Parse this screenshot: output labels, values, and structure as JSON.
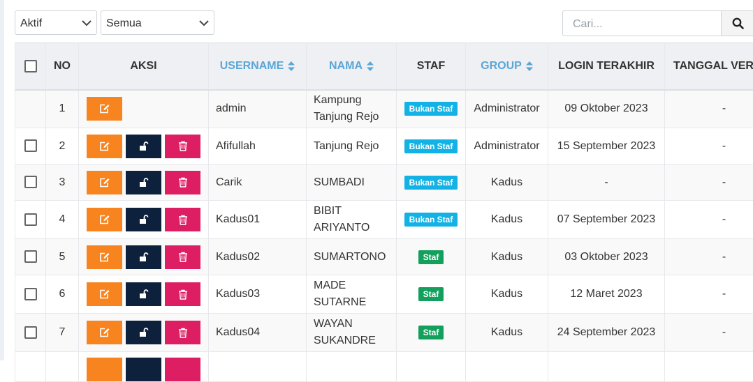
{
  "filters": {
    "status_select": "Aktif",
    "group_select": "Semua"
  },
  "search": {
    "placeholder": "Cari..."
  },
  "table": {
    "headers": {
      "no": "NO",
      "aksi": "AKSI",
      "username": "USERNAME",
      "nama": "NAMA",
      "staf": "STAF",
      "group": "GROUP",
      "login_terakhir": "LOGIN TERAKHIR",
      "tanggal_verifikasi": "TANGGAL VERIFIKASI"
    },
    "rows": [
      {
        "no": "1",
        "username": "admin",
        "nama": "Kampung Tanjung Rejo",
        "staf": "Bukan Staf",
        "group": "Administrator",
        "login": "09 Oktober 2023",
        "tanggal": "-"
      },
      {
        "no": "2",
        "username": "Afifullah",
        "nama": "Tanjung Rejo",
        "staf": "Bukan Staf",
        "group": "Administrator",
        "login": "15 September 2023",
        "tanggal": "-"
      },
      {
        "no": "3",
        "username": "Carik",
        "nama": "SUMBADI",
        "staf": "Bukan Staf",
        "group": "Kadus",
        "login": "-",
        "tanggal": "-"
      },
      {
        "no": "4",
        "username": "Kadus01",
        "nama": "BIBIT ARIYANTO",
        "staf": "Bukan Staf",
        "group": "Kadus",
        "login": "07 September 2023",
        "tanggal": "-"
      },
      {
        "no": "5",
        "username": "Kadus02",
        "nama": "SUMARTONO",
        "staf": "Staf",
        "group": "Kadus",
        "login": "03 Oktober 2023",
        "tanggal": "-"
      },
      {
        "no": "6",
        "username": "Kadus03",
        "nama": "MADE SUTARNE",
        "staf": "Staf",
        "group": "Kadus",
        "login": "12 Maret 2023",
        "tanggal": "-"
      },
      {
        "no": "7",
        "username": "Kadus04",
        "nama": "WAYAN SUKANDRE",
        "staf": "Staf",
        "group": "Kadus",
        "login": "24 September 2023",
        "tanggal": "-"
      }
    ]
  },
  "colors": {
    "edit": "#f7841e",
    "lock": "#0d213d",
    "delete": "#dd1e62",
    "badge_info": "#13b2e4",
    "badge_success": "#12a05c",
    "sortable_header": "#5aa6d6"
  },
  "icons": {
    "edit": "edit-icon",
    "lock": "unlock-icon",
    "delete": "trash-icon",
    "search": "search-icon",
    "sort": "sort-icon",
    "chevron": "chevron-down-icon"
  }
}
